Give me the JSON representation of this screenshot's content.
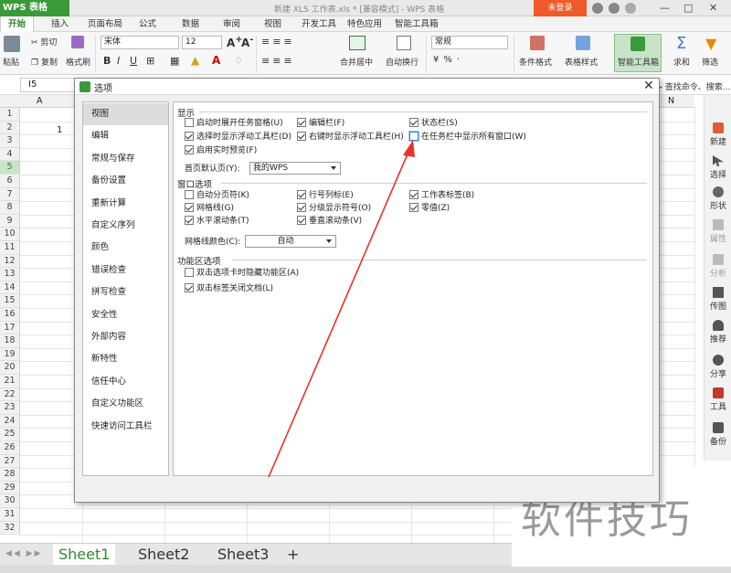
{
  "app": {
    "logo": "WPS 表格",
    "doc_title": "新建 XLS 工作表.xls * [兼容模式] - WPS 表格",
    "login": "未登录"
  },
  "menu": [
    "开始",
    "插入",
    "页面布局",
    "公式",
    "数据",
    "审阅",
    "视图",
    "开发工具",
    "特色应用",
    "智能工具箱"
  ],
  "ribbon": {
    "paste": "粘贴",
    "cut": "剪切",
    "copy": "复制",
    "format_painter": "格式刷",
    "font": "宋体",
    "font_size": "12",
    "merge": "合并居中",
    "wrap": "自动换行",
    "number_format": "常规",
    "cond_format": "条件格式",
    "table_style": "表格样式",
    "smart_toolbox": "智能工具箱",
    "sum": "求和",
    "filter": "筛选",
    "search": "查找命令、搜索..."
  },
  "formula_bar": {
    "cell_ref": "I5"
  },
  "grid": {
    "cols": [
      "A",
      "N"
    ],
    "rows": [
      "1",
      "2",
      "3",
      "4",
      "5",
      "6",
      "7",
      "8",
      "9",
      "10",
      "11",
      "12",
      "13",
      "14",
      "15",
      "16",
      "17",
      "18",
      "19",
      "20",
      "21",
      "22",
      "23",
      "24",
      "25",
      "26",
      "27",
      "28",
      "29",
      "30",
      "31",
      "32"
    ],
    "a1": "1",
    "active_row": "5"
  },
  "right_panel": [
    "新建",
    "选择",
    "形状",
    "属性",
    "分析",
    "传图",
    "推荐",
    "分享",
    "工具",
    "备份"
  ],
  "sheets": [
    "Sheet1",
    "Sheet2",
    "Sheet3",
    "+"
  ],
  "watermark": "软件技巧",
  "dialog": {
    "title": "选项",
    "categories": [
      "视图",
      "编辑",
      "常规与保存",
      "备份设置",
      "重新计算",
      "自定义序列",
      "颜色",
      "错误检查",
      "拼写检查",
      "安全性",
      "外部内容",
      "新特性",
      "信任中心",
      "自定义功能区",
      "快速访问工具栏"
    ],
    "display": {
      "title": "显示",
      "options": [
        {
          "label": "启动时展开任务窗格(U)",
          "checked": false
        },
        {
          "label": "编辑栏(F)",
          "checked": true
        },
        {
          "label": "状态栏(S)",
          "checked": true
        },
        {
          "label": "选择时显示浮动工具栏(D)",
          "checked": true
        },
        {
          "label": "右键时显示浮动工具栏(H)",
          "checked": true
        },
        {
          "label": "在任务栏中显示所有窗口(W)",
          "checked": false
        },
        {
          "label": "启用实时预览(F)",
          "checked": true
        }
      ],
      "homepage_label": "首页默认页(Y):",
      "homepage_value": "我的WPS"
    },
    "window": {
      "title": "窗口选项",
      "options": [
        {
          "label": "自动分页符(K)",
          "checked": false
        },
        {
          "label": "行号列标(E)",
          "checked": true
        },
        {
          "label": "工作表标签(B)",
          "checked": true
        },
        {
          "label": "网格线(G)",
          "checked": true
        },
        {
          "label": "分级显示符号(O)",
          "checked": true
        },
        {
          "label": "零值(Z)",
          "checked": true
        },
        {
          "label": "水平滚动条(T)",
          "checked": true
        },
        {
          "label": "垂直滚动条(V)",
          "checked": true
        }
      ],
      "grid_color_label": "网格线颜色(C):",
      "grid_color_value": "自动"
    },
    "ribbon": {
      "title": "功能区选项",
      "options": [
        {
          "label": "双击选项卡时隐藏功能区(A)",
          "checked": false
        },
        {
          "label": "双击标签关闭文档(L)",
          "checked": true
        }
      ]
    }
  },
  "colors": {
    "accent": "#3a9a3a",
    "arrow": "#e8322a",
    "login": "#f05a28"
  }
}
